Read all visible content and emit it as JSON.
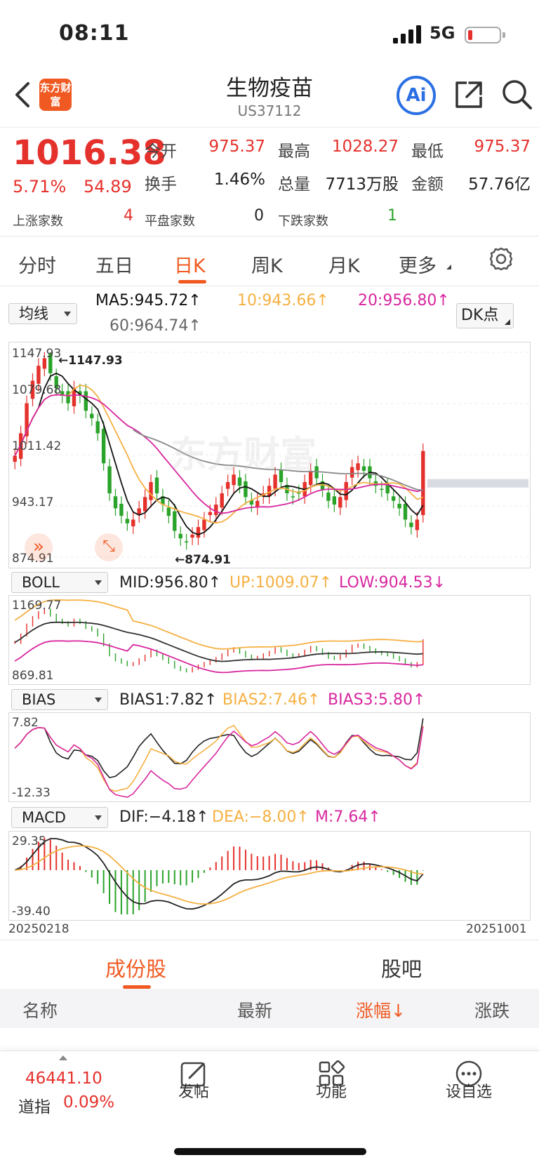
{
  "status": {
    "time": "08:11",
    "network": "5G"
  },
  "header": {
    "logo_text": "东方财富",
    "title": "生物疫苗",
    "code": "US37112",
    "ai_label": "Ai"
  },
  "quote": {
    "price": "1016.38",
    "change_pct": "5.71%",
    "change": "54.89",
    "open_label": "今开",
    "open": "975.37",
    "high_label": "最高",
    "high": "1028.27",
    "low_label": "最低",
    "low": "975.37",
    "turnover_label": "换手",
    "turnover": "1.46%",
    "volume_label": "总量",
    "volume": "7713万股",
    "amount_label": "金额",
    "amount": "57.76亿",
    "up_label": "上涨家数",
    "up_count": "4",
    "flat_label": "平盘家数",
    "flat_count": "0",
    "down_label": "下跌家数",
    "down_count": "1"
  },
  "tabs": [
    "分时",
    "五日",
    "日K",
    "周K",
    "月K",
    "更多"
  ],
  "active_tab": "日K",
  "ma": {
    "selector": "均线",
    "ma5": "MA5:945.72↑",
    "ma10": "10:943.66↑",
    "ma20": "20:956.80↑",
    "ma60": "60:964.74↑",
    "dk": "DK点"
  },
  "kline": {
    "y_top": "1147.93",
    "y_2": "1079.68",
    "y_3": "1011.42",
    "y_4": "943.17",
    "y_bottom": "874.91",
    "high_marker": "1147.93",
    "low_marker": "874.91",
    "watermark": "东方财富"
  },
  "boll": {
    "selector": "BOLL",
    "mid": "MID:956.80↑",
    "up": "UP:1009.07↑",
    "low": "LOW:904.53↓",
    "y_top": "1169.77",
    "y_bottom": "869.81"
  },
  "bias": {
    "selector": "BIAS",
    "b1": "BIAS1:7.82↑",
    "b2": "BIAS2:7.46↑",
    "b3": "BIAS3:5.80↑",
    "y_top": "7.82",
    "y_bottom": "-12.33"
  },
  "macd": {
    "selector": "MACD",
    "dif": "DIF:−4.18↑",
    "dea": "DEA:−8.00↑",
    "m": "M:7.64↑",
    "y_top": "29.35",
    "y_bottom": "-39.40"
  },
  "dates": {
    "start": "20250218",
    "end": "20251001"
  },
  "subtabs": {
    "left": "成份股",
    "right": "股吧"
  },
  "columns": {
    "name": "名称",
    "latest": "最新",
    "change_pct": "涨幅↓",
    "change": "涨跌"
  },
  "footer": {
    "index_value": "46441.10",
    "index_name": "道指",
    "index_pct": "0.09%",
    "post": "发帖",
    "functions": "功能",
    "watchlist": "设自选"
  },
  "colors": {
    "up": "#e5312c",
    "down": "#2aa32a",
    "accent": "#f05a22",
    "ma5": "#111111",
    "ma10": "#f5b042",
    "ma20": "#d8279e",
    "ma60": "#888888"
  },
  "chart_data": {
    "type": "candlestick",
    "title": "",
    "x_range": [
      "20250218",
      "20251001"
    ],
    "ylim": [
      874.91,
      1147.93
    ],
    "y_ticks": [
      1147.93,
      1079.68,
      1011.42,
      943.17,
      874.91
    ],
    "last_close": 1016.38,
    "series": [
      {
        "name": "MA5",
        "last": 945.72
      },
      {
        "name": "10",
        "last": 943.66
      },
      {
        "name": "20",
        "last": 956.8
      },
      {
        "name": "60",
        "last": 964.74
      }
    ],
    "close_approx": [
      1010,
      1040,
      1080,
      1110,
      1130,
      1140,
      1120,
      1100,
      1090,
      1080,
      1100,
      1090,
      1070,
      1060,
      1040,
      1000,
      960,
      940,
      930,
      920,
      925,
      940,
      955,
      975,
      960,
      945,
      930,
      910,
      900,
      895,
      905,
      915,
      925,
      935,
      945,
      960,
      975,
      985,
      970,
      955,
      945,
      950,
      960,
      970,
      985,
      975,
      960,
      955,
      960,
      975,
      990,
      980,
      965,
      950,
      945,
      955,
      975,
      995,
      1000,
      990,
      980,
      970,
      965,
      960,
      950,
      940,
      925,
      915,
      925,
      1016.38
    ]
  }
}
